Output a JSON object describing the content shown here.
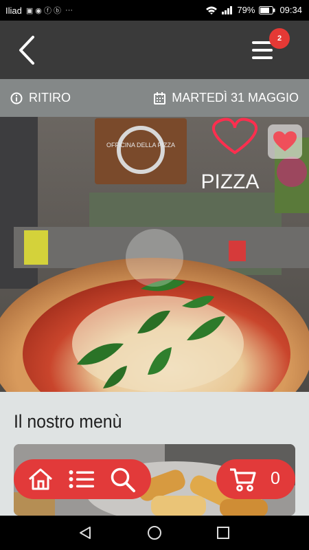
{
  "status_bar": {
    "carrier": "Iliad",
    "battery_percent": "79%",
    "time": "09:34",
    "more": "···"
  },
  "header": {
    "back_icon": "chevron-left-icon",
    "menu_icon": "hamburger-icon",
    "cart_badge": "2"
  },
  "info_bar": {
    "mode_label": "RITIRO",
    "date_label": "MARTEDÌ 31 MAGGIO"
  },
  "hero": {
    "neon_sign": "PIZZA",
    "wall_sign": "OFFICINA DELLA PIZZA"
  },
  "main": {
    "section_title": "Il nostro menù"
  },
  "bottom_bar": {
    "cart_count": "0"
  },
  "colors": {
    "accent": "#e23a3a",
    "header_bg": "#3a3a3a",
    "info_bg": "#848888",
    "page_bg": "#dfe3e3"
  }
}
